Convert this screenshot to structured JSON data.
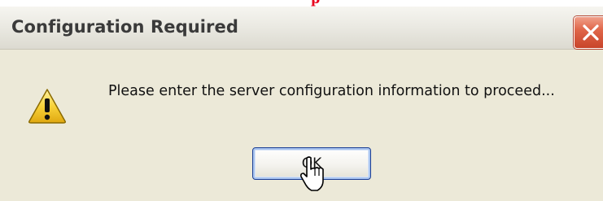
{
  "dialog": {
    "title": "Configuration Required",
    "message": "Please enter the server configuration information to proceed...",
    "ok_label": "OK"
  },
  "icons": {
    "warning": "warning-icon",
    "close": "close-icon",
    "cursor": "mouse-cursor-icon"
  },
  "colors": {
    "dialog_background": "#ece9d8",
    "title_text": "#3a3a3a",
    "close_button": "#e0674a",
    "button_focus_border": "#1c3f94",
    "warning_fill": "#f8d23a",
    "red_fragment": "#e8001c"
  }
}
